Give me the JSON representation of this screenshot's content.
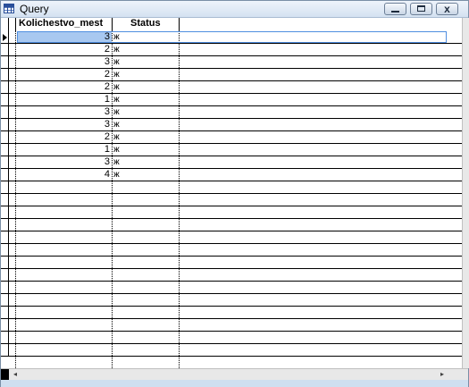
{
  "window": {
    "title": "Query",
    "close_glyph": "x"
  },
  "grid": {
    "columns": [
      "Kolichestvo_mest",
      "Status"
    ],
    "rows": [
      {
        "kolichestvo_mest": "3",
        "status": "ж"
      },
      {
        "kolichestvo_mest": "2",
        "status": "ж"
      },
      {
        "kolichestvo_mest": "3",
        "status": "ж"
      },
      {
        "kolichestvo_mest": "2",
        "status": "ж"
      },
      {
        "kolichestvo_mest": "2",
        "status": "ж"
      },
      {
        "kolichestvo_mest": "1",
        "status": "ж"
      },
      {
        "kolichestvo_mest": "3",
        "status": "ж"
      },
      {
        "kolichestvo_mest": "3",
        "status": "ж"
      },
      {
        "kolichestvo_mest": "2",
        "status": "ж"
      },
      {
        "kolichestvo_mest": "1",
        "status": "ж"
      },
      {
        "kolichestvo_mest": "3",
        "status": "ж"
      },
      {
        "kolichestvo_mest": "4",
        "status": "ж"
      }
    ],
    "empty_rows": 14
  },
  "scrollbar": {
    "left_arrow": "◂",
    "right_arrow": "▸"
  },
  "icons": {
    "app": "query-table-icon",
    "current_record": "current-record-pointer-icon"
  },
  "colors": {
    "selection_fill": "#a8c8f0",
    "selection_border": "#4f8ee0",
    "titlebar": "#d4e2f1"
  }
}
